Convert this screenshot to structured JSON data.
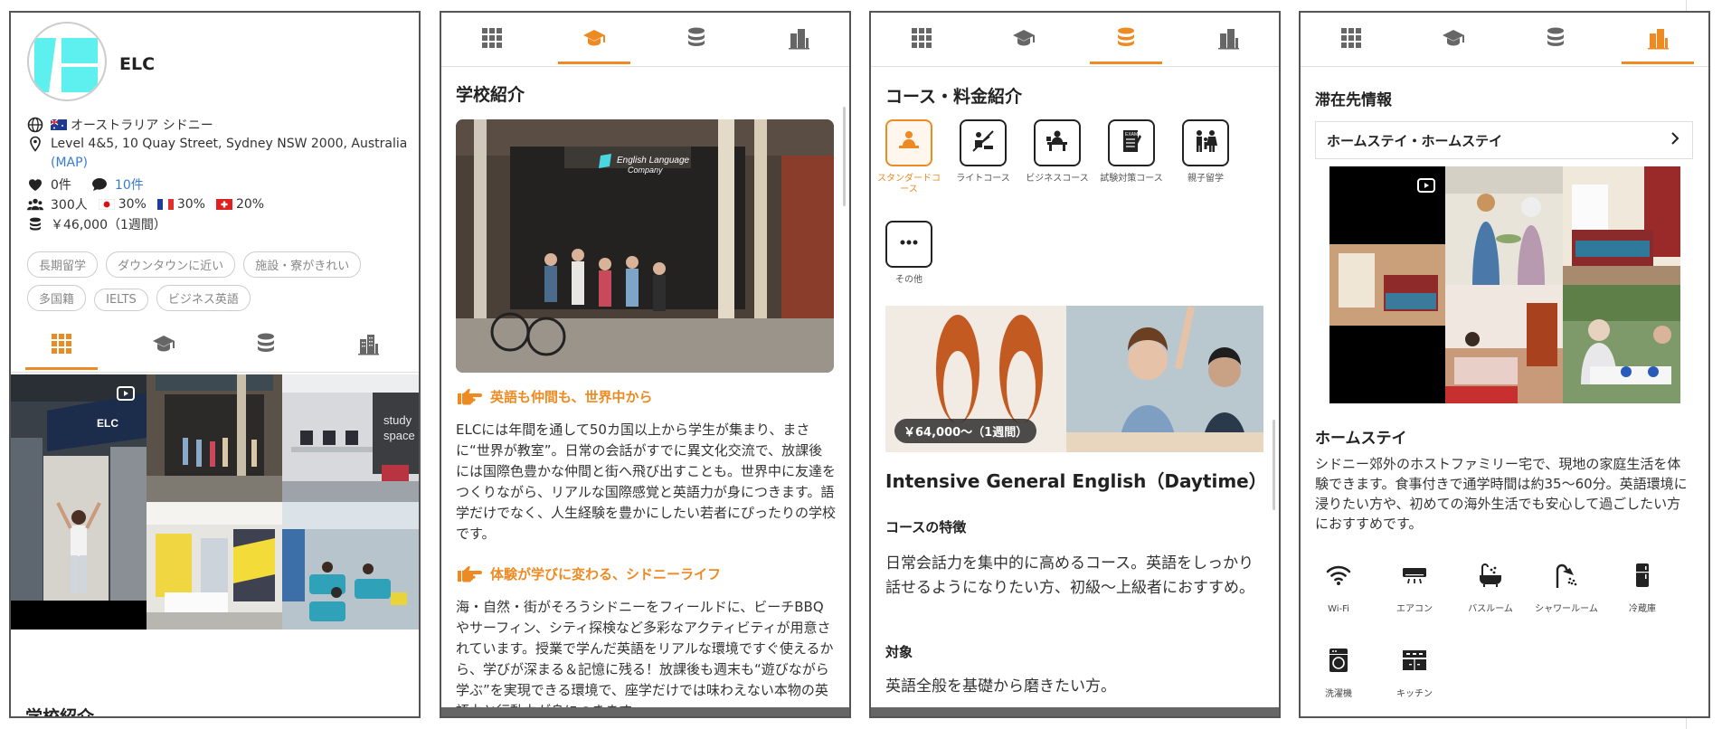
{
  "school": {
    "name": "ELC",
    "location": "オーストラリア シドニー",
    "address": "Level 4&5, 10 Quay Street, Sydney NSW 2000, Australia",
    "map_link": "(MAP)",
    "likes": "0件",
    "comments": "10件",
    "students": "300人",
    "nationality": [
      {
        "flag": "japan-flag",
        "percent": "30%"
      },
      {
        "flag": "france-flag",
        "percent": "30%"
      },
      {
        "flag": "switzerland-flag",
        "percent": "20%"
      }
    ],
    "price": "￥46,000（1週間）",
    "tags": [
      "長期留学",
      "ダウンタウンに近い",
      "施設・寮がきれい",
      "多国籍",
      "IELTS",
      "ビジネス英語"
    ],
    "bottom_title": "学校紹介"
  },
  "tabs": [
    {
      "icon": "grid-icon"
    },
    {
      "icon": "graduation-cap-icon"
    },
    {
      "icon": "database-coins-icon"
    },
    {
      "icon": "building-icon"
    }
  ],
  "intro": {
    "title": "学校紹介",
    "heading1": "英語も仲間も、世界中から",
    "para1": "ELCには年間を通して50カ国以上から学生が集まり、まさに“世界が教室”。日常の会話がすでに異文化交流で、放課後には国際色豊かな仲間と街へ飛び出すことも。世界中に友達をつくりながら、リアルな国際感覚と英語力が身につきます。語学だけでなく、人生経験を豊かにしたい若者にぴったりの学校です。",
    "heading2": "体験が学びに変わる、シドニーライフ",
    "para2": "海・自然・街がそろうシドニーをフィールドに、ビーチBBQやサーフィン、シティ探検など多彩なアクティビティが用意されています。授業で学んだ英語をリアルな環境ですぐ使えるから、学びが深まる＆記憶に残る！放課後も週末も“遊びながら学ぶ”を実現できる環境で、座学だけでは味わえない本物の英語力と行動力が身につきます。"
  },
  "courses": {
    "title": "コース・料金紹介",
    "categories": [
      {
        "label": "スタンダードコース",
        "icon": "person-desk-icon"
      },
      {
        "label": "ライトコース",
        "icon": "light-course-icon"
      },
      {
        "label": "ビジネスコース",
        "icon": "business-desk-icon"
      },
      {
        "label": "試験対策コース",
        "icon": "exam-icon"
      },
      {
        "label": "親子留学",
        "icon": "family-icon"
      },
      {
        "label": "その他",
        "icon": "more-icon"
      }
    ],
    "price_badge": "￥64,000～（1週間）",
    "course_name": "Intensive General English（Daytime）",
    "feature_head": "コースの特徴",
    "feature_text": "日常会話力を集中的に高めるコース。英語をしっかり話せるようになりたい方、初級〜上級者におすすめ。",
    "target_head": "対象",
    "target_text": "英語全般を基礎から磨きたい方。"
  },
  "stay": {
    "title": "滞在先情報",
    "select_label": "ホームステイ・ホームステイ",
    "section_head": "ホームステイ",
    "description": "シドニー郊外のホストファミリー宅で、現地の家庭生活を体験できます。食事付きで通学時間は約35〜60分。英語環境に浸りたい方や、初めての海外生活でも安心して過ごしたい方におすすめです。",
    "amenities": [
      {
        "label": "Wi-Fi",
        "icon": "wifi-icon"
      },
      {
        "label": "エアコン",
        "icon": "air-conditioner-icon"
      },
      {
        "label": "バスルーム",
        "icon": "bathtub-icon"
      },
      {
        "label": "シャワールーム",
        "icon": "shower-icon"
      },
      {
        "label": "冷蔵庫",
        "icon": "refrigerator-icon"
      },
      {
        "label": "洗濯機",
        "icon": "washing-machine-icon"
      },
      {
        "label": "キッチン",
        "icon": "kitchen-icon"
      }
    ]
  },
  "colors": {
    "accent": "#ee8a22",
    "link": "#3a7bd5",
    "logo": "#5ef0ee"
  }
}
